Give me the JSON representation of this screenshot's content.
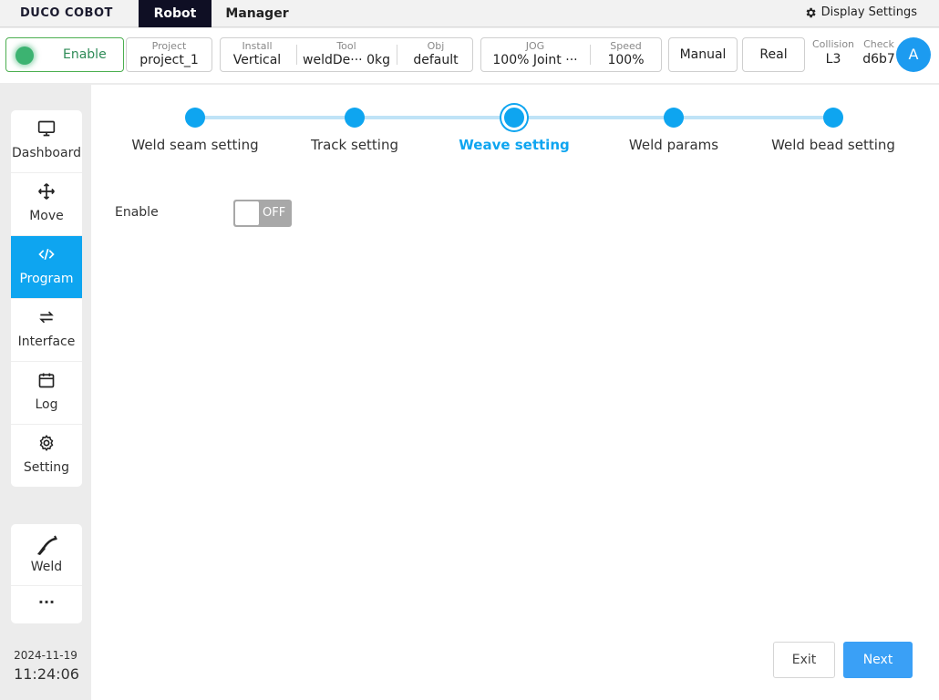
{
  "app": {
    "logo": "DUCO COBOT"
  },
  "menu": {
    "tabs": [
      {
        "label": "Robot"
      },
      {
        "label": "Manager"
      }
    ],
    "display_settings": "Display Settings"
  },
  "status": {
    "enable": "Enable",
    "project": {
      "label": "Project",
      "value": "project_1"
    },
    "install": {
      "label": "Install",
      "value": "Vertical"
    },
    "tool": {
      "label": "Tool",
      "value": "weldDe··· 0kg"
    },
    "obj": {
      "label": "Obj",
      "value": "default"
    },
    "jog": {
      "label": "JOG",
      "value": "100%  Joint ···"
    },
    "speed": {
      "label": "Speed",
      "value": "100%"
    },
    "mode": "Manual",
    "sim": "Real",
    "collision": {
      "label": "Collision",
      "value": "L3"
    },
    "check": {
      "label": "Check",
      "value": "d6b7"
    },
    "avatar": "A"
  },
  "sidebar": {
    "items": [
      {
        "label": "Dashboard",
        "icon": "monitor-icon"
      },
      {
        "label": "Move",
        "icon": "move-arrows-icon"
      },
      {
        "label": "Program",
        "icon": "code-icon"
      },
      {
        "label": "Interface",
        "icon": "swap-icon"
      },
      {
        "label": "Log",
        "icon": "calendar-icon"
      },
      {
        "label": "Setting",
        "icon": "gear-icon"
      }
    ],
    "plugins": [
      {
        "label": "Weld",
        "icon": "weld-torch-icon"
      },
      {
        "label": "···",
        "icon": "more-icon"
      }
    ],
    "date": "2024-11-19",
    "time": "11:24:06"
  },
  "wizard": {
    "steps": [
      {
        "label": "Weld seam setting"
      },
      {
        "label": "Track setting"
      },
      {
        "label": "Weave setting"
      },
      {
        "label": "Weld params"
      },
      {
        "label": "Weld bead setting"
      }
    ],
    "current_step": 3
  },
  "form": {
    "enable_label": "Enable",
    "enable_state": "OFF"
  },
  "actions": {
    "exit": "Exit",
    "next": "Next"
  },
  "colors": {
    "accent": "#0ea5f0",
    "enable_green": "#3cb371",
    "primary_button": "#3aa0f6"
  }
}
